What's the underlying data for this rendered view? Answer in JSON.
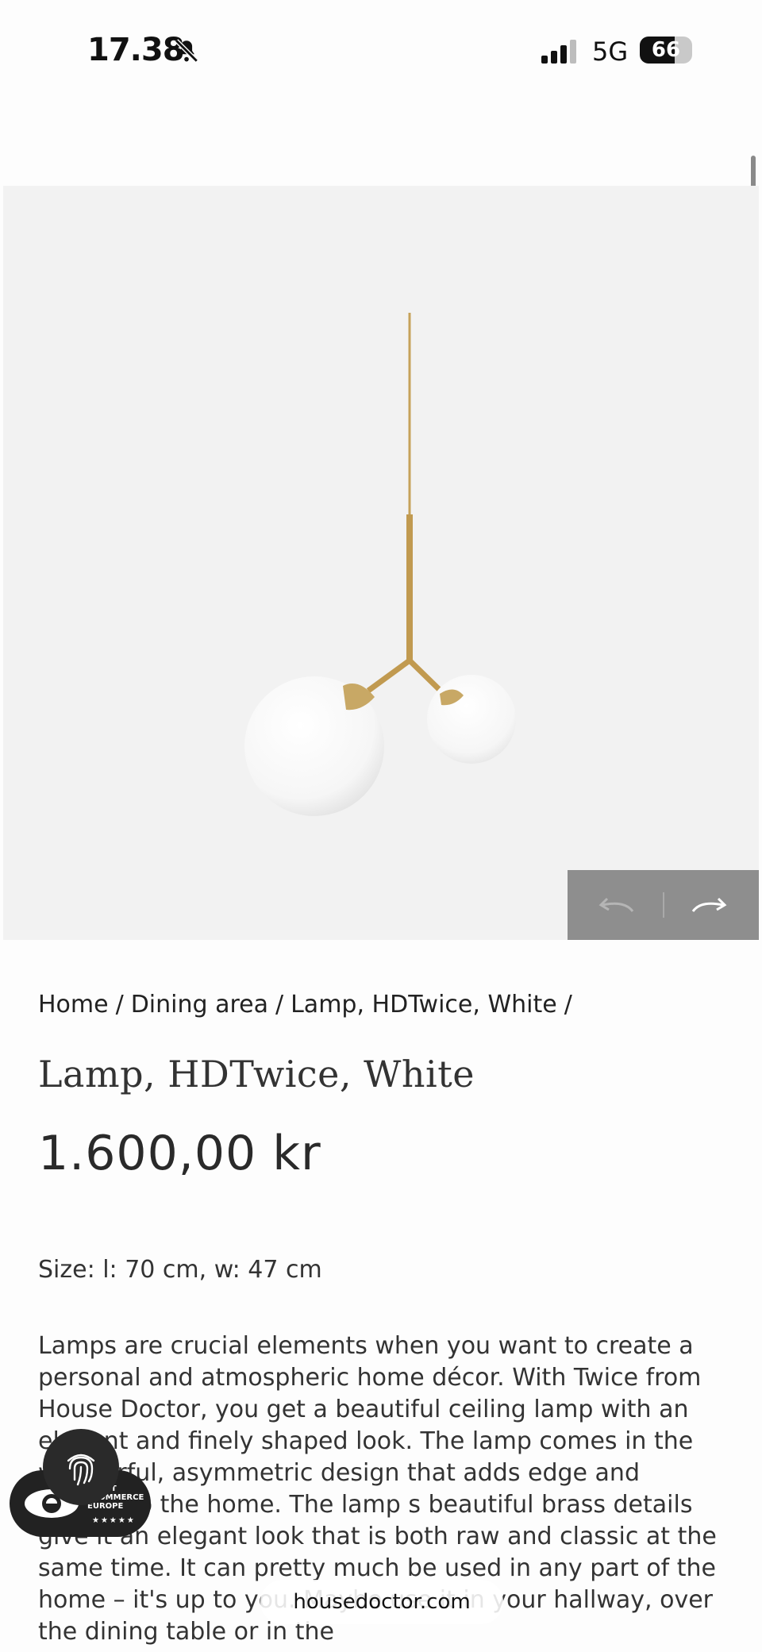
{
  "status_bar": {
    "time": "17.38",
    "network": "5G",
    "battery_percent": "66",
    "battery_level": 0.66
  },
  "icons": {
    "bell": "bell-slash-icon",
    "signal": "cellular-signal-icon",
    "prev": "undo-arrow-icon",
    "next": "redo-arrow-icon",
    "fingerprint": "fingerprint-icon",
    "eye": "eye-logo-icon"
  },
  "breadcrumb": {
    "items": [
      "Home",
      "Dining area",
      "Lamp, HDTwice, White"
    ],
    "separator": "/"
  },
  "product": {
    "title": "Lamp, HDTwice, White",
    "price": "1.600,00 kr",
    "size": "Size: l: 70 cm, w: 47 cm",
    "description": "Lamps are crucial elements when you want to create a personal and atmospheric home décor. With Twice from House Doctor, you get a beautiful ceiling lamp with an elegant and finely shaped look. The lamp comes in the wonderful, asymmetric design that adds edge and beauty to the home. The lamp s beautiful brass details give it an elegant look that is both raw and classic at the same time. It can pretty much be used in any part of the home – it's up to you. Maybe use it in your hallway, over the dining table or in the"
  },
  "trust_badge": {
    "line1": "TRUST",
    "line2": "ECOMMERCE",
    "line3": "EUROPE",
    "stars": "★★★★★"
  },
  "browser": {
    "url": "housedoctor.com"
  },
  "colors": {
    "background": "#fdfdfd",
    "image_bg": "#f2f2f2",
    "nav_bg": "#8e8e8e",
    "brass": "#c6a25a",
    "text": "#2b2b2b"
  }
}
